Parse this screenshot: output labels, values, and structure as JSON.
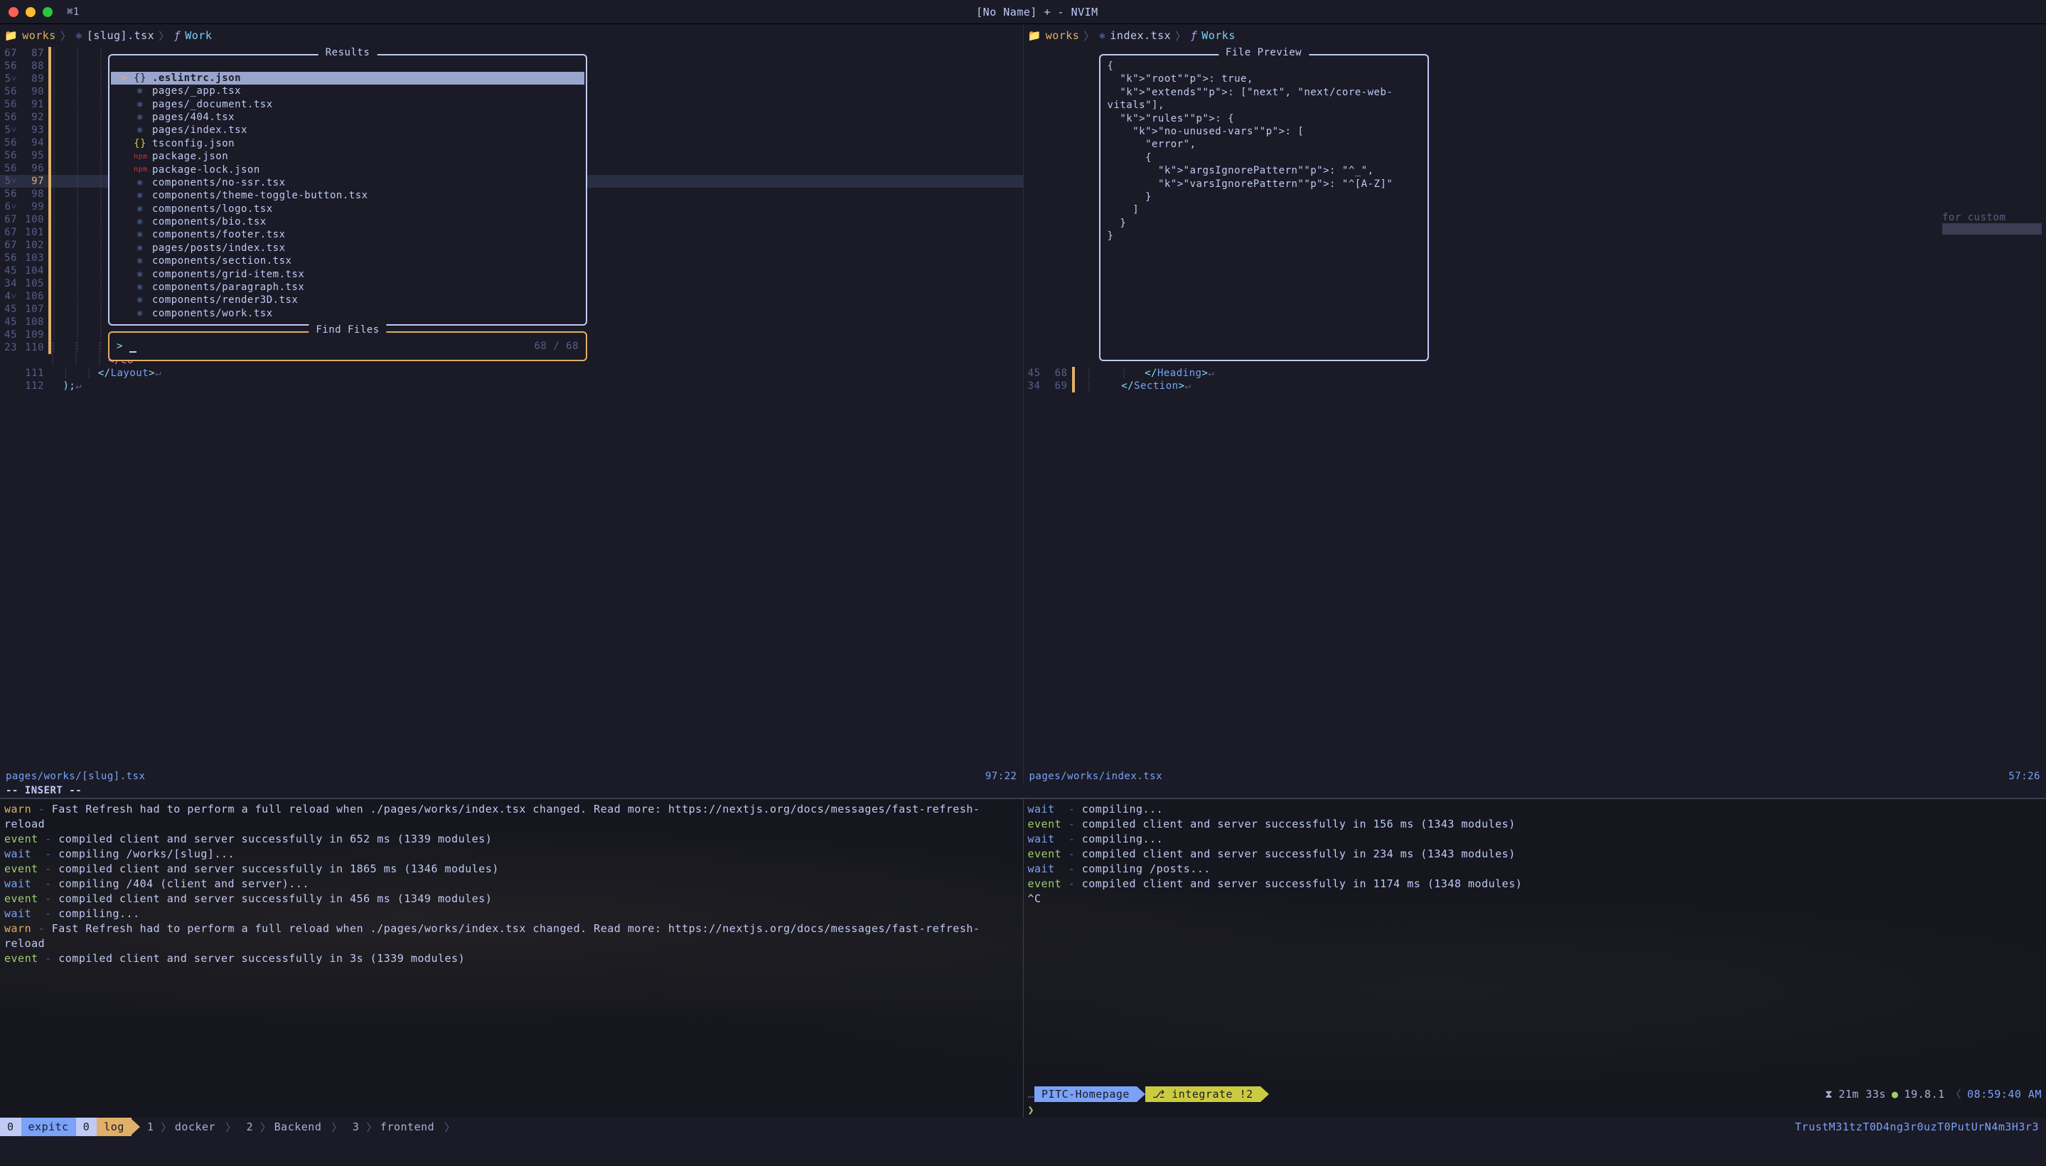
{
  "titlebar": {
    "shortcut": "⌘1",
    "title": "[No Name] + - NVIM"
  },
  "left_pane": {
    "winbar": {
      "folder": "works",
      "file": "[slug].tsx",
      "func": "Work"
    },
    "gutter": [
      {
        "a": "67",
        "b": "87"
      },
      {
        "a": "56",
        "b": "88"
      },
      {
        "a": "5˅",
        "b": "89"
      },
      {
        "a": "56",
        "b": "90"
      },
      {
        "a": "56",
        "b": "91"
      },
      {
        "a": "56",
        "b": "92"
      },
      {
        "a": "5˅",
        "b": "93"
      },
      {
        "a": "56",
        "b": "94"
      },
      {
        "a": "56",
        "b": "95"
      },
      {
        "a": "56",
        "b": "96"
      },
      {
        "a": "5˅",
        "b": "97",
        "cur": true
      },
      {
        "a": "56",
        "b": "98"
      },
      {
        "a": "6˅",
        "b": "99"
      },
      {
        "a": "67",
        "b": "100"
      },
      {
        "a": "67",
        "b": "101"
      },
      {
        "a": "67",
        "b": "102"
      },
      {
        "a": "56",
        "b": "103"
      },
      {
        "a": "45",
        "b": "104"
      },
      {
        "a": "34",
        "b": "105"
      },
      {
        "a": "4˅",
        "b": "106"
      },
      {
        "a": "45",
        "b": "107"
      },
      {
        "a": "45",
        "b": "108"
      },
      {
        "a": "45",
        "b": "109"
      },
      {
        "a": "23",
        "b": "110"
      }
    ],
    "tail_lines": {
      "l109": "</",
      "l110": "</Co",
      "l111_num": "111",
      "l111": "</Layout>",
      "l112_num": "112",
      "l112": ");"
    },
    "status": {
      "path": "pages/works/[slug].tsx",
      "pos": "97:22"
    },
    "mode": "-- INSERT --"
  },
  "right_pane": {
    "winbar": {
      "folder": "works",
      "file": "index.tsx",
      "func": "Works"
    },
    "gutter": [
      {
        "a": "45",
        "b": "68"
      },
      {
        "a": "34",
        "b": "69"
      }
    ],
    "lines": {
      "l68": "</Heading>",
      "l69": "</Section>"
    },
    "phantom": "for custom",
    "status": {
      "path": "pages/works/index.tsx",
      "pos": "57:26"
    }
  },
  "telescope": {
    "results_title": "Results",
    "prompt_title": "Find Files",
    "prompt_count": "68 / 68",
    "items": [
      {
        "icon": "⚛",
        "path": "components/work.tsx"
      },
      {
        "icon": "⚛",
        "path": "components/render3D.tsx"
      },
      {
        "icon": "⚛",
        "path": "components/paragraph.tsx"
      },
      {
        "icon": "⚛",
        "path": "components/grid-item.tsx"
      },
      {
        "icon": "⚛",
        "path": "components/section.tsx"
      },
      {
        "icon": "⚛",
        "path": "pages/posts/index.tsx"
      },
      {
        "icon": "⚛",
        "path": "components/footer.tsx"
      },
      {
        "icon": "⚛",
        "path": "components/bio.tsx"
      },
      {
        "icon": "⚛",
        "path": "components/logo.tsx"
      },
      {
        "icon": "⚛",
        "path": "components/theme-toggle-button.tsx"
      },
      {
        "icon": "⚛",
        "path": "components/no-ssr.tsx"
      },
      {
        "icon": "npm",
        "path": "package-lock.json",
        "npm": true
      },
      {
        "icon": "npm",
        "path": "package.json",
        "npm": true
      },
      {
        "icon": "{}",
        "path": "tsconfig.json",
        "json": true
      },
      {
        "icon": "⚛",
        "path": "pages/index.tsx"
      },
      {
        "icon": "⚛",
        "path": "pages/404.tsx"
      },
      {
        "icon": "⚛",
        "path": "pages/_document.tsx"
      },
      {
        "icon": "⚛",
        "path": "pages/_app.tsx"
      },
      {
        "icon": "{}",
        "path": ".eslintrc.json",
        "json": true,
        "selected": true
      }
    ],
    "preview_title": "File Preview",
    "preview_lines": [
      "{",
      "  \"root\": true,",
      "  \"extends\": [\"next\", \"next/core-web-vitals\"],",
      "  \"rules\": {",
      "    \"no-unused-vars\": [",
      "      \"error\",",
      "      {",
      "        \"argsIgnorePattern\": \"^_\",",
      "        \"varsIgnorePattern\": \"^[A-Z]\"",
      "      }",
      "    ]",
      "  }",
      "}"
    ]
  },
  "terminal": {
    "left": [
      {
        "t": "warn",
        "d": " - ",
        "m": "Fast Refresh had to perform a full reload when ./pages/works/index.tsx changed. Read more: https://nextjs.org/docs/messages/fast-refresh-reload"
      },
      {
        "t": "event",
        "d": " - ",
        "m": "compiled client and server successfully in 652 ms (1339 modules)"
      },
      {
        "t": "wait",
        "d": "  - ",
        "m": "compiling /works/[slug]..."
      },
      {
        "t": "event",
        "d": " - ",
        "m": "compiled client and server successfully in 1865 ms (1346 modules)"
      },
      {
        "t": "wait",
        "d": "  - ",
        "m": "compiling /404 (client and server)..."
      },
      {
        "t": "event",
        "d": " - ",
        "m": "compiled client and server successfully in 456 ms (1349 modules)"
      },
      {
        "t": "wait",
        "d": "  - ",
        "m": "compiling..."
      },
      {
        "t": "warn",
        "d": " - ",
        "m": "Fast Refresh had to perform a full reload when ./pages/works/index.tsx changed. Read more: https://nextjs.org/docs/messages/fast-refresh-reload"
      },
      {
        "t": "event",
        "d": " - ",
        "m": "compiled client and server successfully in 3s (1339 modules)"
      }
    ],
    "right": [
      {
        "t": "wait",
        "d": "  - ",
        "m": "compiling..."
      },
      {
        "t": "event",
        "d": " - ",
        "m": "compiled client and server successfully in 156 ms (1343 modules)"
      },
      {
        "t": "wait",
        "d": "  - ",
        "m": "compiling..."
      },
      {
        "t": "event",
        "d": " - ",
        "m": "compiled client and server successfully in 234 ms (1343 modules)"
      },
      {
        "t": "wait",
        "d": "  - ",
        "m": "compiling /posts..."
      },
      {
        "t": "event",
        "d": " - ",
        "m": "compiled client and server successfully in 1174 ms (1348 modules)"
      },
      {
        "t": "plain",
        "m": "^C"
      }
    ],
    "status_right": {
      "repo": "PITC-Homepage",
      "branch_icon": "⎇",
      "branch": "integrate !2",
      "hourglass": "⧗",
      "elapsed": "21m 33s",
      "node": "19.8.1",
      "time": "08:59:40 AM",
      "prompt": "❯"
    }
  },
  "tmux": {
    "session_num": "0",
    "session": "expitc",
    "windows": [
      {
        "num": "0",
        "name": "log",
        "cur": true
      },
      {
        "num": "1",
        "name": "docker"
      },
      {
        "num": "2",
        "name": "Backend"
      },
      {
        "num": "3",
        "name": "frontend"
      }
    ],
    "right": "TrustM31tzT0D4ng3r0uzT0PutUrN4m3H3r3"
  }
}
